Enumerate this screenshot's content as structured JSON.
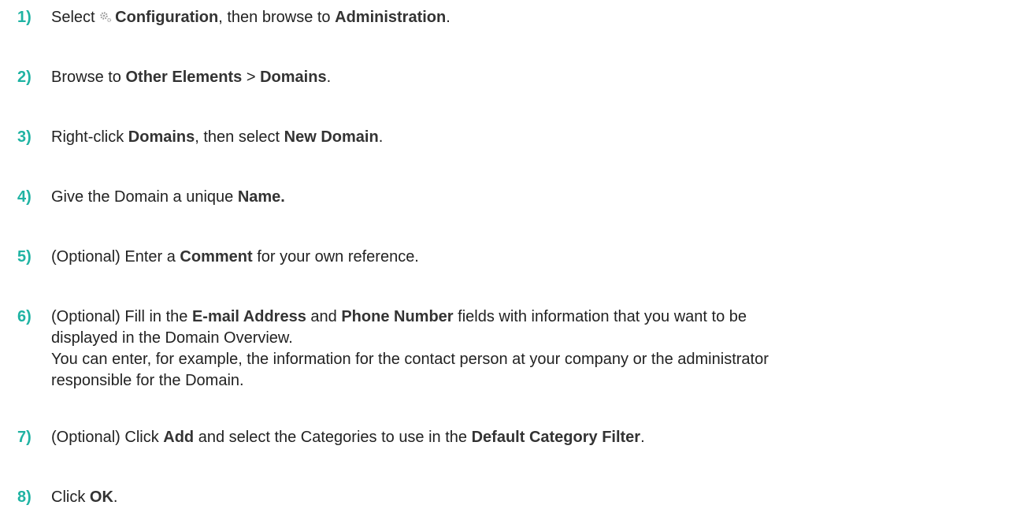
{
  "steps": [
    {
      "num": "1)",
      "lines": [
        [
          {
            "t": "Select "
          },
          {
            "icon": "gear-icon"
          },
          {
            "t": "Configuration",
            "b": true
          },
          {
            "t": ", then browse to "
          },
          {
            "t": "Administration",
            "b": true
          },
          {
            "t": "."
          }
        ]
      ]
    },
    {
      "num": "2)",
      "lines": [
        [
          {
            "t": "Browse to "
          },
          {
            "t": "Other Elements",
            "b": true
          },
          {
            "t": " > "
          },
          {
            "t": "Domains",
            "b": true
          },
          {
            "t": "."
          }
        ]
      ]
    },
    {
      "num": "3)",
      "lines": [
        [
          {
            "t": "Right-click "
          },
          {
            "t": "Domains",
            "b": true
          },
          {
            "t": ", then select "
          },
          {
            "t": "New Domain",
            "b": true
          },
          {
            "t": "."
          }
        ]
      ]
    },
    {
      "num": "4)",
      "lines": [
        [
          {
            "t": "Give the Domain a unique "
          },
          {
            "t": "Name.",
            "b": true
          }
        ]
      ]
    },
    {
      "num": "5)",
      "lines": [
        [
          {
            "t": "(Optional) Enter a "
          },
          {
            "t": "Comment",
            "b": true
          },
          {
            "t": " for your own reference."
          }
        ]
      ]
    },
    {
      "num": "6)",
      "lines": [
        [
          {
            "t": "(Optional) Fill in the "
          },
          {
            "t": "E-mail Address",
            "b": true
          },
          {
            "t": " and "
          },
          {
            "t": "Phone Number",
            "b": true
          },
          {
            "t": " fields with information that you want to be"
          }
        ],
        [
          {
            "t": "displayed in the Domain Overview."
          }
        ],
        [
          {
            "t": "You can enter, for example, the information for the contact person at your company or the administrator"
          }
        ],
        [
          {
            "t": "responsible for the Domain."
          }
        ]
      ]
    },
    {
      "num": "7)",
      "lines": [
        [
          {
            "t": "(Optional) Click "
          },
          {
            "t": "Add",
            "b": true
          },
          {
            "t": " and select the Categories to use in the "
          },
          {
            "t": "Default Category Filter",
            "b": true
          },
          {
            "t": "."
          }
        ]
      ]
    },
    {
      "num": "8)",
      "lines": [
        [
          {
            "t": "Click "
          },
          {
            "t": "OK",
            "b": true
          },
          {
            "t": "."
          }
        ]
      ]
    }
  ]
}
